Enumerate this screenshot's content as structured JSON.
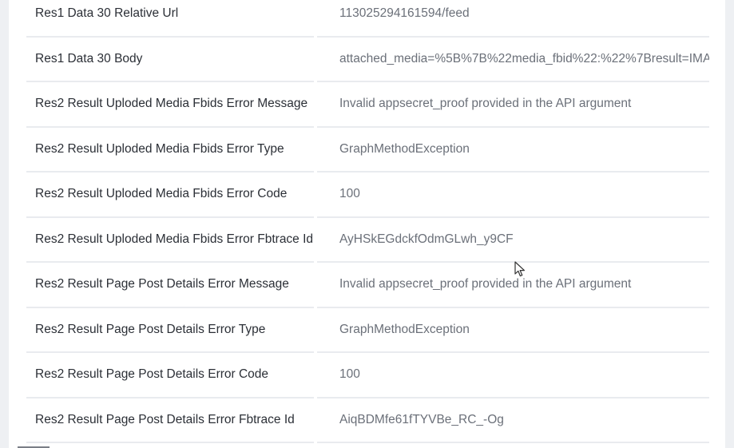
{
  "rows": [
    {
      "label": "Res1 Data 30 Relative Url",
      "value": "113025294161594/feed"
    },
    {
      "label": "Res1 Data 30 Body",
      "value": "attached_media=%5B%7B%22media_fbid%22:%22%7Bresult=IMA"
    },
    {
      "label": "Res2 Result Uploded Media Fbids Error Message",
      "value": "Invalid appsecret_proof provided in the API argument"
    },
    {
      "label": "Res2 Result Uploded Media Fbids Error Type",
      "value": "GraphMethodException"
    },
    {
      "label": "Res2 Result Uploded Media Fbids Error Code",
      "value": "100"
    },
    {
      "label": "Res2 Result Uploded Media Fbids Error Fbtrace Id",
      "value": "AyHSkEGdckfOdmGLwh_y9CF"
    },
    {
      "label": "Res2 Result Page Post Details Error Message",
      "value": "Invalid appsecret_proof provided in the API argument"
    },
    {
      "label": "Res2 Result Page Post Details Error Type",
      "value": "GraphMethodException"
    },
    {
      "label": "Res2 Result Page Post Details Error Code",
      "value": "100"
    },
    {
      "label": "Res2 Result Page Post Details Error Fbtrace Id",
      "value": "AiqBDMfe61fTYVBe_RC_-Og"
    }
  ],
  "cursor_icon": "mouse-pointer-icon"
}
